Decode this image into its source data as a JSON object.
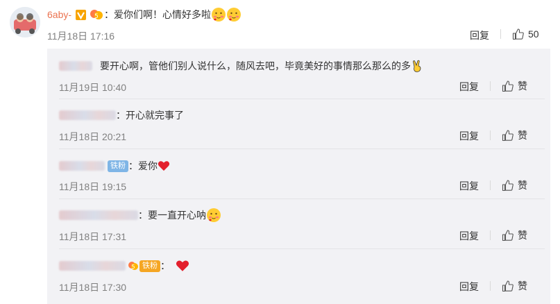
{
  "comment": {
    "author": "6aby-",
    "text": "：爱你们啊！心情好多啦",
    "time": "11月18日 17:16",
    "reply_label": "回复",
    "like_count": "50"
  },
  "replies": [
    {
      "text": "要开心啊，管他们别人说什么，随风去吧，毕竟美好的事情那么那么的多",
      "time": "11月19日 10:40",
      "reply_label": "回复",
      "like_label": "赞"
    },
    {
      "text": "：开心就完事了",
      "time": "11月18日 20:21",
      "reply_label": "回复",
      "like_label": "赞"
    },
    {
      "badge": "铁粉",
      "text": "：爱你",
      "time": "11月18日 19:15",
      "reply_label": "回复",
      "like_label": "赞"
    },
    {
      "text": "：要一直开心呐",
      "time": "11月18日 17:31",
      "reply_label": "回复",
      "like_label": "赞"
    },
    {
      "badge": "铁粉",
      "text": "：",
      "time": "11月18日 17:30",
      "reply_label": "回复",
      "like_label": "赞"
    }
  ],
  "colors": {
    "author": "#eb7350",
    "badge_blue": "#7fb5e6",
    "verified": "#f7a400",
    "heart": "#e3202d"
  },
  "icons": [
    "avatar",
    "verified-icon",
    "vip-icon",
    "blush-emoji",
    "thumbs-up-icon",
    "victory-hand-emoji",
    "heart-emoji"
  ]
}
